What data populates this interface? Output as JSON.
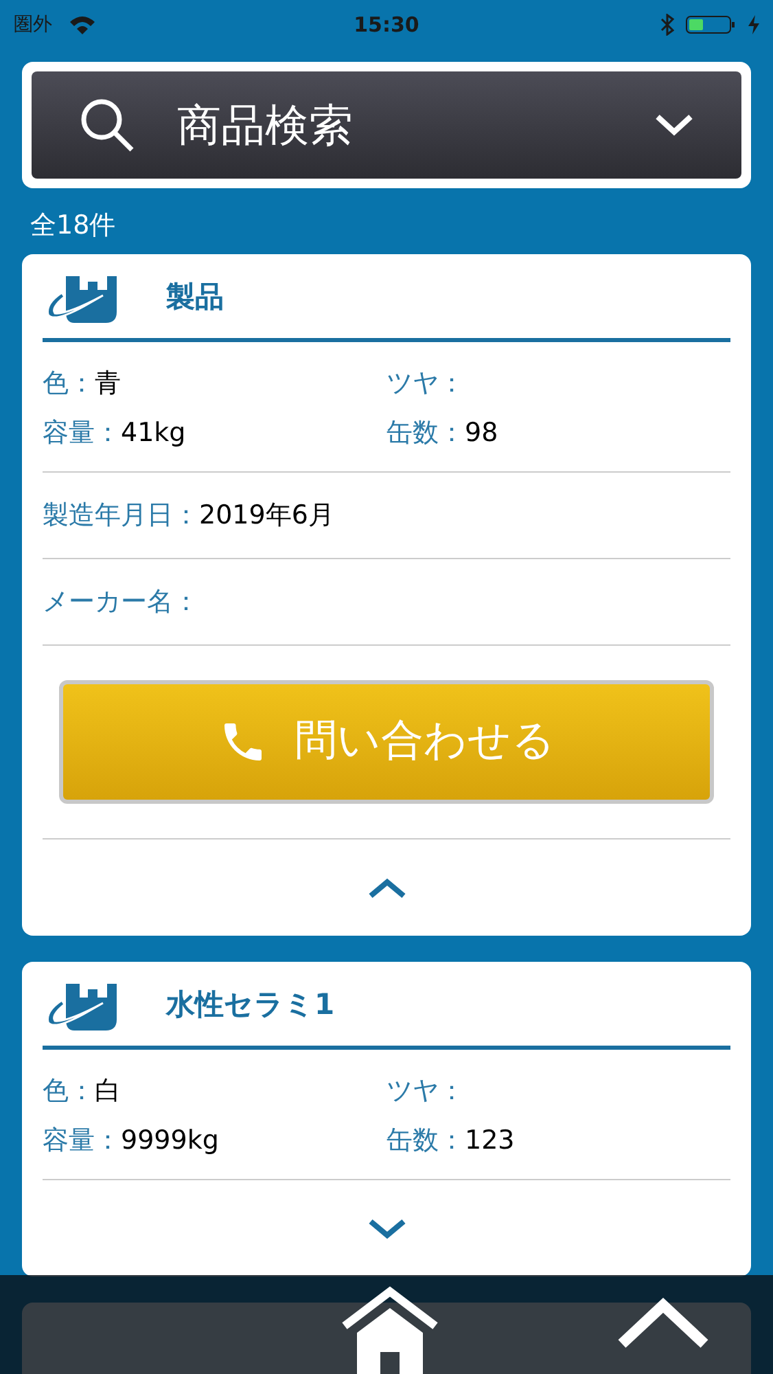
{
  "status_bar": {
    "carrier": "圏外",
    "time": "15:30"
  },
  "search": {
    "label": "商品検索"
  },
  "result_count": "全18件",
  "cards": [
    {
      "title": "製品",
      "expanded": true,
      "fields": [
        {
          "label": "色：",
          "value": "青"
        },
        {
          "label": "ツヤ："
        },
        {
          "label": "容量：",
          "value": "41kg"
        },
        {
          "label": "缶数：",
          "value": "98"
        }
      ],
      "details": [
        {
          "label": "製造年月日：",
          "value": "2019年6月"
        },
        {
          "label": "メーカー名："
        }
      ],
      "contact_button": "問い合わせる"
    },
    {
      "title": "水性セラミ1",
      "expanded": false,
      "fields": [
        {
          "label": "色：",
          "value": "白"
        },
        {
          "label": "ツヤ："
        },
        {
          "label": "容量：",
          "value": "9999kg"
        },
        {
          "label": "缶数：",
          "value": "123"
        }
      ]
    }
  ]
}
